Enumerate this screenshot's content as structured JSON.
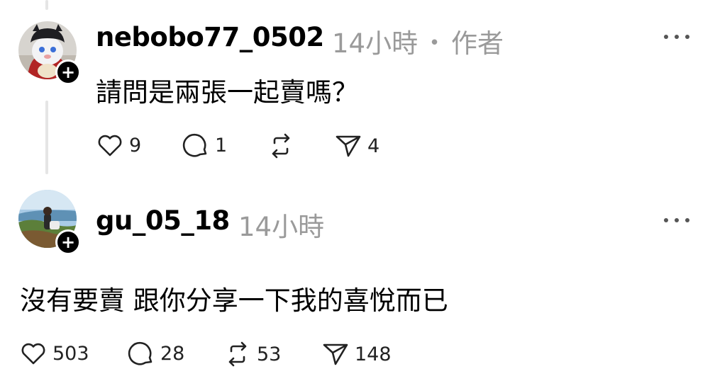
{
  "comments": [
    {
      "username": "nebobo77_0502",
      "time": "14小時",
      "separator": "•",
      "tag": "作者",
      "text": "請問是兩張一起賣嗎？",
      "likes": "9",
      "replies": "1",
      "shares": "4"
    },
    {
      "username": "gu_05_18",
      "time": "14小時",
      "text": "沒有要賣 跟你分享一下我的喜悅而已",
      "likes": "503",
      "replies": "28",
      "reposts": "53",
      "shares": "148"
    }
  ],
  "icons": {
    "like": "heart-icon",
    "reply": "comment-icon",
    "repost": "repost-icon",
    "share": "send-icon",
    "more": "more-options-icon",
    "follow": "plus-icon"
  },
  "colors": {
    "meta_gray": "#9a9a9a",
    "thread_line": "#e5e5e5"
  }
}
